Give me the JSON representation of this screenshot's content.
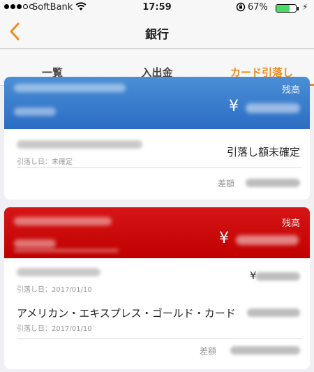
{
  "status_bar": {
    "carrier": "SoftBank",
    "time": "17:59",
    "battery_pct": "67%",
    "battery_level": 0.67
  },
  "nav": {
    "title": "銀行",
    "back_icon": "chevron-left-icon"
  },
  "tabs": [
    {
      "label": "一覧",
      "active": false
    },
    {
      "label": "入出金",
      "active": false
    },
    {
      "label": "カード引落し",
      "active": true
    }
  ],
  "cards": [
    {
      "balance_label": "残高",
      "currency": "¥",
      "rows": [
        {
          "date": "引落し日：未確定",
          "status": "引落し額未確定"
        }
      ],
      "diff_label": "差額"
    },
    {
      "balance_label": "残高",
      "currency": "¥",
      "rows": [
        {
          "date": "引落し日：2017/01/10",
          "currency": "¥"
        },
        {
          "name": "アメリカン・エキスプレス・ゴールド・カード",
          "date": "引落し日：2017/01/10"
        }
      ],
      "diff_label": "差額"
    }
  ],
  "colors": {
    "accent": "#f08a1c",
    "card1_header": "#3a7fd0",
    "card2_header": "#cc0000"
  }
}
